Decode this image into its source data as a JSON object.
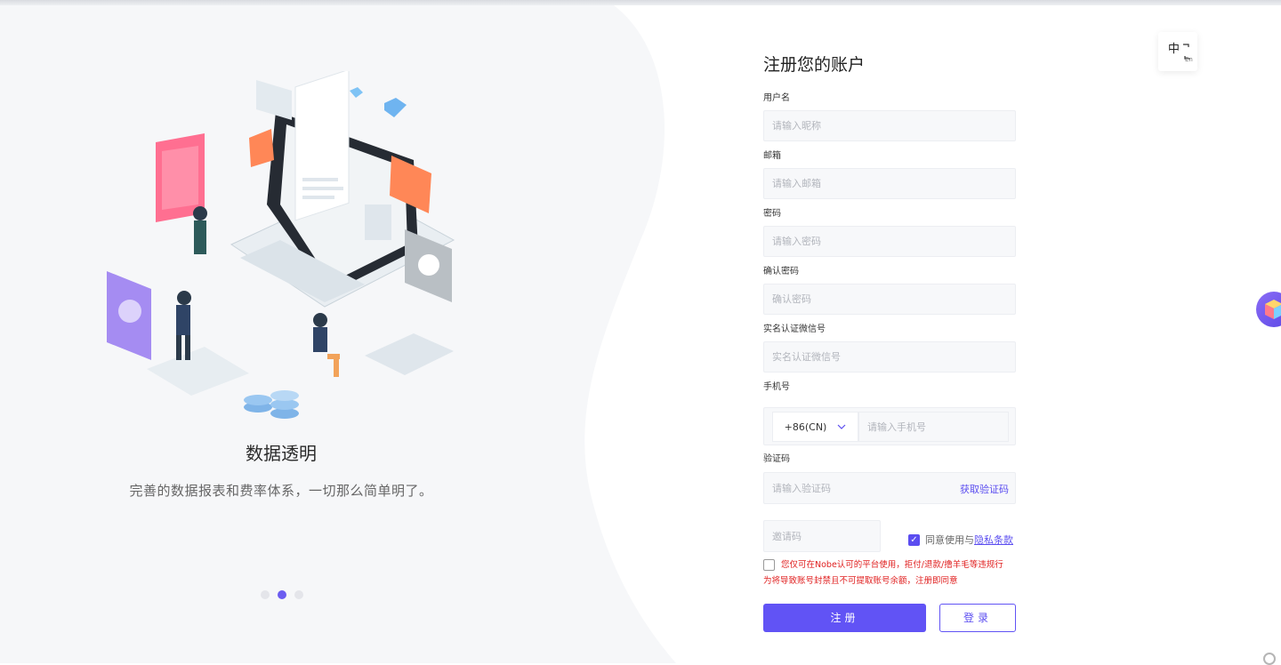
{
  "carousel": {
    "title": "数据透明",
    "description": "完善的数据报表和费率体系，一切那么简单明了。",
    "active_index": 1,
    "count": 3
  },
  "form": {
    "title": "注册您的账户",
    "username": {
      "label": "用户名",
      "placeholder": "请输入昵称"
    },
    "email": {
      "label": "邮箱",
      "placeholder": "请输入邮箱"
    },
    "password": {
      "label": "密码",
      "placeholder": "请输入密码"
    },
    "confirm_password": {
      "label": "确认密码",
      "placeholder": "确认密码"
    },
    "wechat": {
      "label": "实名认证微信号",
      "placeholder": "实名认证微信号"
    },
    "phone": {
      "label": "手机号",
      "country_code": "+86(CN)",
      "placeholder": "请输入手机号"
    },
    "verify_code": {
      "label": "验证码",
      "placeholder": "请输入验证码",
      "get_code": "获取验证码"
    },
    "invite_code": {
      "placeholder": "邀请码"
    },
    "agree": {
      "text": "同意使用与",
      "link": "隐私条款",
      "checked": true
    },
    "warning": {
      "line1": "您仅可在Nobe认可的平台使用，拒付/退款/撸羊毛等违规行",
      "line2": "为将导致账号封禁且不可提取账号余额，注册即同意",
      "checked": false
    },
    "register_button": "注册",
    "login_button": "登录"
  },
  "language": {
    "zh": "中",
    "en": "En"
  },
  "colors": {
    "accent": "#6153f5",
    "warning": "#e02020"
  }
}
